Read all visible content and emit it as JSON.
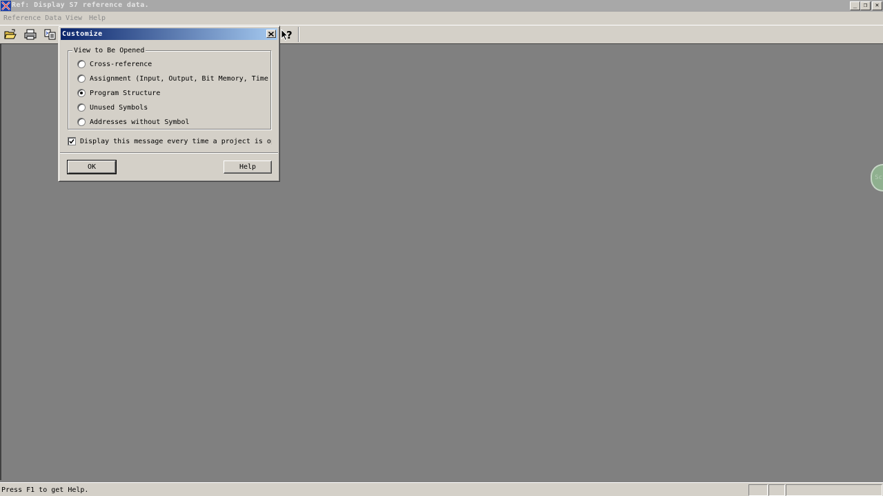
{
  "window": {
    "title": "Ref: Display S7 reference data.",
    "minimize_glyph": "_",
    "restore_glyph": "❐",
    "close_glyph": "✕"
  },
  "menu": {
    "items": [
      "Reference Data",
      "View",
      "Help"
    ]
  },
  "toolbar": {
    "icons": [
      "open-folder-icon",
      "print-icon",
      "copy-view-icon",
      "context-help-icon"
    ]
  },
  "dialog": {
    "title": "Customize",
    "group_label": "View to Be Opened",
    "options": [
      {
        "label": "Cross-reference",
        "checked": false
      },
      {
        "label": "Assignment (Input, Output, Bit Memory, Timers,",
        "checked": false
      },
      {
        "label": "Program Structure",
        "checked": true
      },
      {
        "label": "Unused Symbols",
        "checked": false
      },
      {
        "label": "Addresses without Symbol",
        "checked": false
      }
    ],
    "checkbox_label": "Display this message every time a project is open",
    "checkbox_checked": true,
    "ok_label": "OK",
    "help_label": "Help"
  },
  "side_widget": {
    "text": "Sc"
  },
  "statusbar": {
    "text": "Press F1 to get Help."
  },
  "colors": {
    "title_active_start": "#0a246a",
    "title_active_end": "#a6caf0",
    "face": "#d4d0c8",
    "workspace": "#808080"
  }
}
